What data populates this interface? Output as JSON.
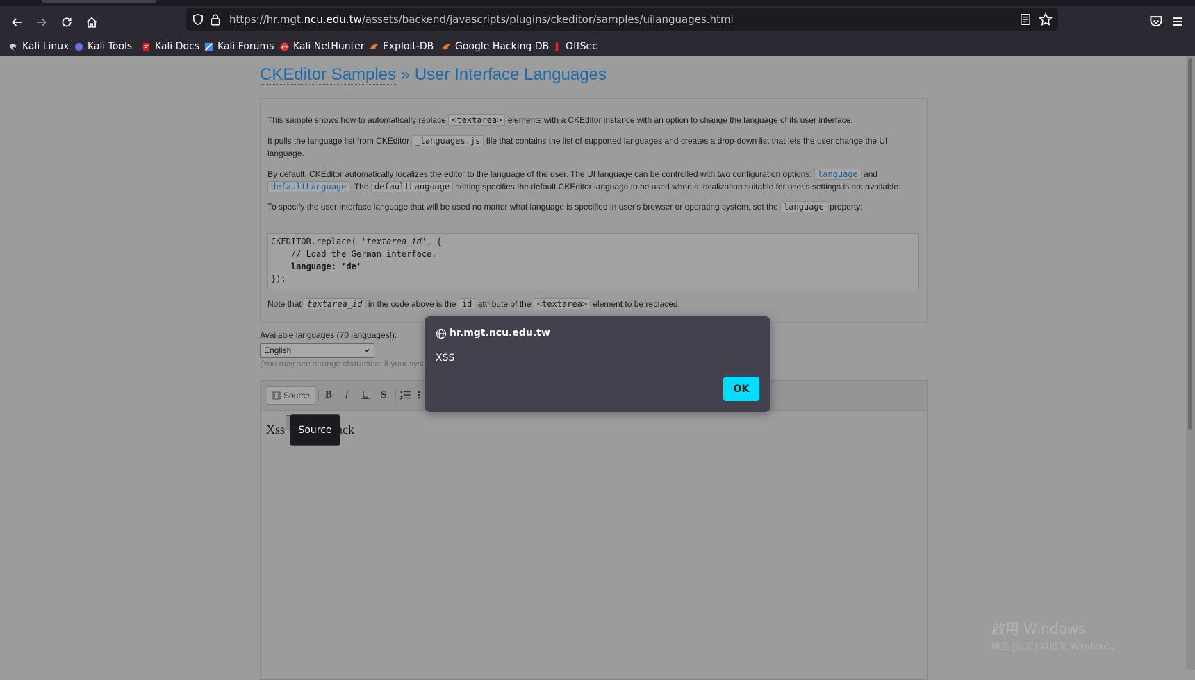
{
  "browser": {
    "url_prefix": "https://hr.mgt.",
    "url_domain": "ncu.edu.tw",
    "url_path": "/assets/backend/javascripts/plugins/ckeditor/samples/uilanguages.html"
  },
  "bookmarks": [
    {
      "label": "Kali Linux",
      "icon": "kali-dragon-icon",
      "color": "#fbfbfe"
    },
    {
      "label": "Kali Tools",
      "icon": "kali-tools-icon",
      "color": "#5aa0ff"
    },
    {
      "label": "Kali Docs",
      "icon": "kali-docs-icon",
      "color": "#e02020"
    },
    {
      "label": "Kali Forums",
      "icon": "kali-forums-icon",
      "color": "#3b8bff"
    },
    {
      "label": "Kali NetHunter",
      "icon": "nethunter-icon",
      "color": "#e03030"
    },
    {
      "label": "Exploit-DB",
      "icon": "exploit-db-icon",
      "color": "#f07a20"
    },
    {
      "label": "Google Hacking DB",
      "icon": "ghdb-icon",
      "color": "#f07a20"
    },
    {
      "label": "OffSec",
      "icon": "offsec-icon",
      "color": "#e02020"
    }
  ],
  "page": {
    "title_crumb": "CKEditor Samples",
    "title_sep": " » ",
    "title_main": "User Interface Languages",
    "p1": {
      "before": "This sample shows how to automatically replace ",
      "code": "<textarea>",
      "after": " elements with a CKEditor instance with an option to change the language of its user interface."
    },
    "p2": {
      "before": "It pulls the language list from CKEditor ",
      "code": "_languages.js",
      "after": " file that contains the list of supported languages and creates a drop-down list that lets the user change the UI language."
    },
    "p3": {
      "before": "By default, CKEditor automatically localizes the editor to the language of the user. The UI language can be controlled with two configuration options: ",
      "code1": "language",
      "mid1": " and ",
      "code2": "defaultLanguage",
      "mid2": ". The ",
      "code3": "defaultLanguage",
      "after": " setting specifies the default CKEditor language to be used when a localization suitable for user's settings is not available."
    },
    "p4": {
      "before": "To specify the user interface language that will be used no matter what language is specified in user's browser or operating system, set the ",
      "code": "language",
      "after": " property:"
    },
    "code_lines": {
      "l1a": "CKEDITOR.replace( ",
      "l1b": "'textarea_id'",
      "l1c": ", {",
      "l2": "    // Load the German interface.",
      "l3": "    language: 'de'",
      "l4": "});"
    },
    "p5": {
      "before": "Note that ",
      "code1": "textarea_id",
      "mid1": " in the code above is the ",
      "code2": "id",
      "mid2": " attribute of the ",
      "code3": "<textarea>",
      "after": " element to be replaced."
    },
    "lang_label": "Available languages (70 languages!):",
    "lang_selected": "English",
    "lang_note": "(You may see strange characters if your system does not support the selected language)"
  },
  "editor": {
    "source_label": "Source",
    "bold_label": "B",
    "italic_label": "I",
    "underline_label": "U",
    "strike_label": "S",
    "content_before": "Xss",
    "content_after": "Attack",
    "tooltip": "Source"
  },
  "dialog": {
    "origin": "hr.mgt.ncu.edu.tw",
    "message": "XSS",
    "ok_label": "OK"
  },
  "watermark": {
    "line1": "啟用 Windows",
    "line2": "移至 [設定] 以啟用 Windows。"
  }
}
